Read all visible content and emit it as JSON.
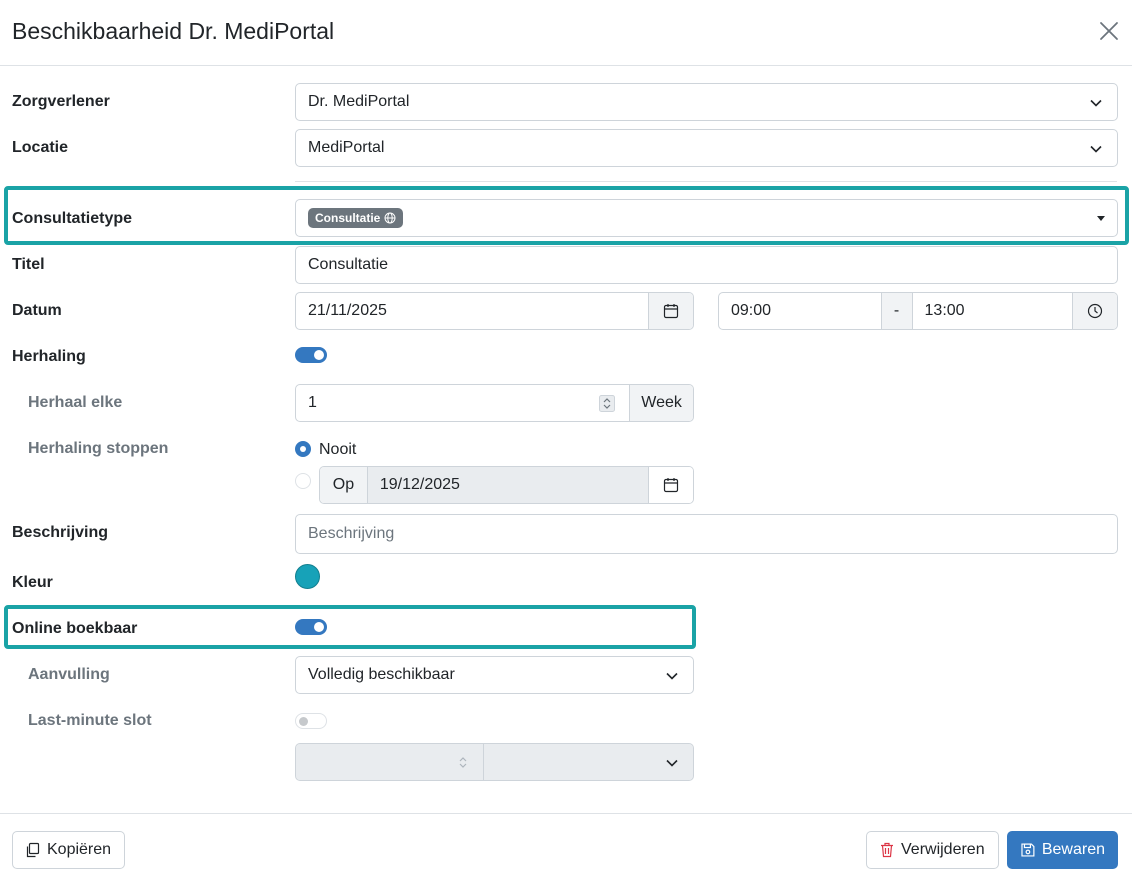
{
  "modal": {
    "title": "Beschikbaarheid Dr. MediPortal"
  },
  "form": {
    "zorgverlener": {
      "label": "Zorgverlener",
      "value": "Dr. MediPortal"
    },
    "locatie": {
      "label": "Locatie",
      "value": "MediPortal"
    },
    "consultatietype": {
      "label": "Consultatietype",
      "badge": "Consultatie"
    },
    "titel": {
      "label": "Titel",
      "value": "Consultatie"
    },
    "datum": {
      "label": "Datum",
      "date": "21/11/2025",
      "start_time": "09:00",
      "separator": "-",
      "end_time": "13:00"
    },
    "herhaling": {
      "label": "Herhaling",
      "enabled": true
    },
    "herhaal_elke": {
      "label": "Herhaal elke",
      "value": "1",
      "unit": "Week"
    },
    "herhaling_stoppen": {
      "label": "Herhaling stoppen",
      "option_never": "Nooit",
      "option_on_prefix": "Op",
      "option_on_date": "19/12/2025",
      "selected": "Nooit"
    },
    "beschrijving": {
      "label": "Beschrijving",
      "placeholder": "Beschrijving"
    },
    "kleur": {
      "label": "Kleur",
      "value": "#17a2b8"
    },
    "online_boekbaar": {
      "label": "Online boekbaar",
      "enabled": true
    },
    "aanvulling": {
      "label": "Aanvulling",
      "value": "Volledig beschikbaar"
    },
    "last_minute": {
      "label": "Last-minute slot",
      "enabled": false
    }
  },
  "footer": {
    "copy_label": "Kopiëren",
    "delete_label": "Verwijderen",
    "save_label": "Bewaren"
  },
  "colors": {
    "accent": "#3478c0",
    "highlight": "#1aa3a6",
    "danger": "#dc3545"
  }
}
